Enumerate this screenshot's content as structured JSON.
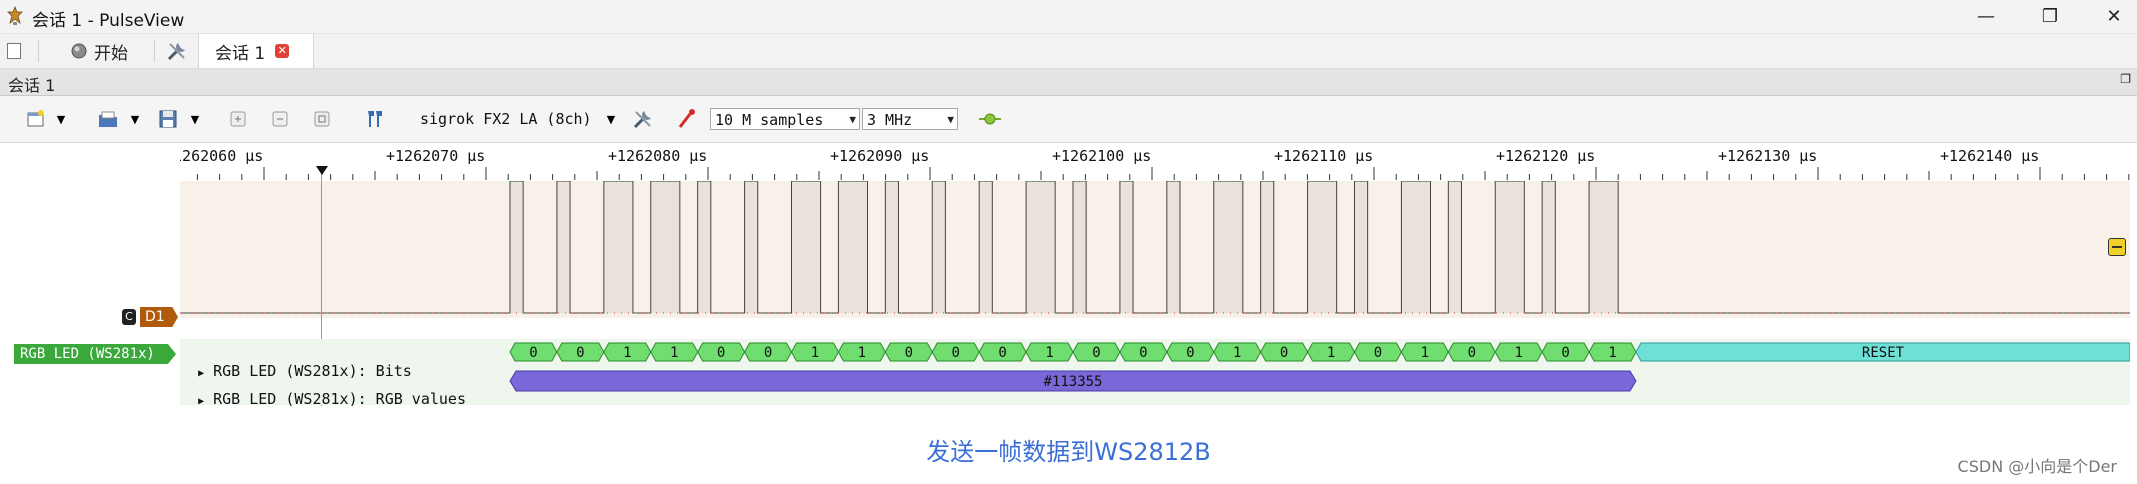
{
  "window": {
    "title": "会话 1 - PulseView",
    "minimize_glyph": "—",
    "maximize_glyph": "❐",
    "close_glyph": "✕"
  },
  "tabs": [
    {
      "label": "开始",
      "icon": "record-icon"
    },
    {
      "label": "会话 1",
      "icon": "tools-icon",
      "closable": true
    }
  ],
  "session": {
    "title": "会话 1"
  },
  "toolbar": {
    "device": "sigrok FX2 LA (8ch)",
    "samples": "10 M samples",
    "rate": "3 MHz"
  },
  "ruler": {
    "unit": "μs",
    "labels": [
      "+1262060",
      "+1262070",
      "+1262080",
      "+1262090",
      "+1262100",
      "+1262110",
      "+1262120",
      "+1262130",
      "+1262140"
    ],
    "cursor_time": "+1262060"
  },
  "channels": [
    {
      "name": "D1",
      "color": "#b05a0c"
    }
  ],
  "decoder": {
    "tag": "RGB LED (WS281x)",
    "tag_color": "#3aa83a",
    "rows": [
      {
        "label": "RGB LED (WS281x): Bits"
      },
      {
        "label": "RGB LED (WS281x): RGB values"
      }
    ],
    "bits": [
      "0",
      "0",
      "1",
      "1",
      "0",
      "0",
      "1",
      "1",
      "0",
      "0",
      "0",
      "1",
      "0",
      "0",
      "0",
      "1",
      "0",
      "1",
      "0",
      "1",
      "0",
      "1",
      "0",
      "1"
    ],
    "reset_label": "RESET",
    "rgb_value": "#113355",
    "bits_color": "#6fdd6f",
    "reset_color": "#6fe0d6",
    "rgb_color": "#7b68d8"
  },
  "caption": "发送一帧数据到WS2812B",
  "watermark": "CSDN @小向是个Der"
}
